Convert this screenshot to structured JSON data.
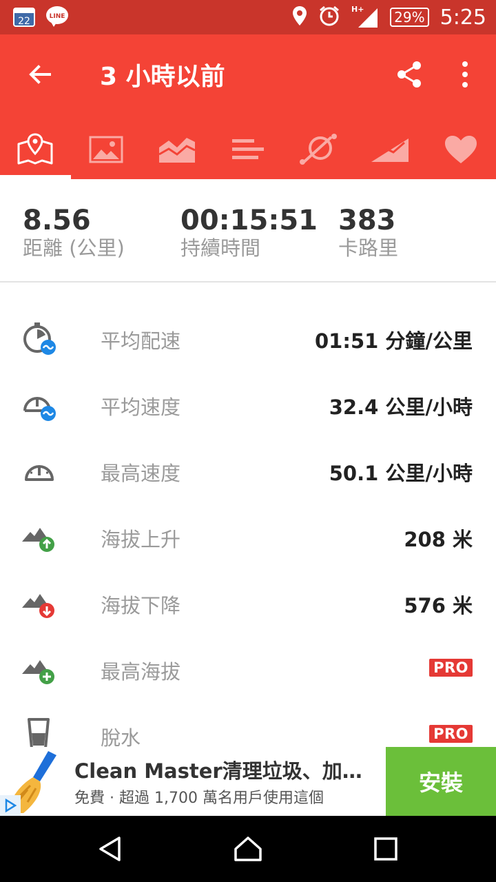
{
  "status_bar": {
    "time": "5:25",
    "battery": "29%",
    "network": "H+",
    "notifications": [
      "calendar-icon",
      "line-icon"
    ],
    "calendar_day": "22",
    "line_label": "LINE"
  },
  "app_bar": {
    "title": "3 小時以前",
    "tabs": [
      {
        "icon": "map-pin-icon",
        "active": true
      },
      {
        "icon": "photo-icon",
        "active": false
      },
      {
        "icon": "area-chart-icon",
        "active": false
      },
      {
        "icon": "bars-icon",
        "active": false
      },
      {
        "icon": "route-icon",
        "active": false
      },
      {
        "icon": "elevation-icon",
        "active": false
      },
      {
        "icon": "heart-icon",
        "active": false
      }
    ]
  },
  "summary": {
    "distance": {
      "value": "8.56",
      "label": "距離 (公里)"
    },
    "duration": {
      "value": "00:15:51",
      "label": "持續時間"
    },
    "calories": {
      "value": "383",
      "label": "卡路里"
    }
  },
  "metrics": [
    {
      "icon": "avg-pace-icon",
      "label": "平均配速",
      "value": "01:51 分鐘/公里"
    },
    {
      "icon": "avg-speed-icon",
      "label": "平均速度",
      "value": "32.4 公里/小時"
    },
    {
      "icon": "max-speed-icon",
      "label": "最高速度",
      "value": "50.1 公里/小時"
    },
    {
      "icon": "elevation-gain-icon",
      "label": "海拔上升",
      "value": "208 米"
    },
    {
      "icon": "elevation-loss-icon",
      "label": "海拔下降",
      "value": "576 米"
    },
    {
      "icon": "max-elevation-icon",
      "label": "最高海拔",
      "value": "PRO"
    },
    {
      "icon": "dehydration-icon",
      "label": "脫水",
      "value": "PRO"
    }
  ],
  "ad": {
    "title": "Clean Master清理垃圾、加…",
    "subtitle": "免費 · 超過 1,700 萬名用戶使用這個",
    "install_label": "安裝"
  },
  "colors": {
    "status_bar": "#c9352b",
    "app_bar": "#f44336",
    "pro_badge": "#e53935",
    "install": "#6bbf3a"
  }
}
